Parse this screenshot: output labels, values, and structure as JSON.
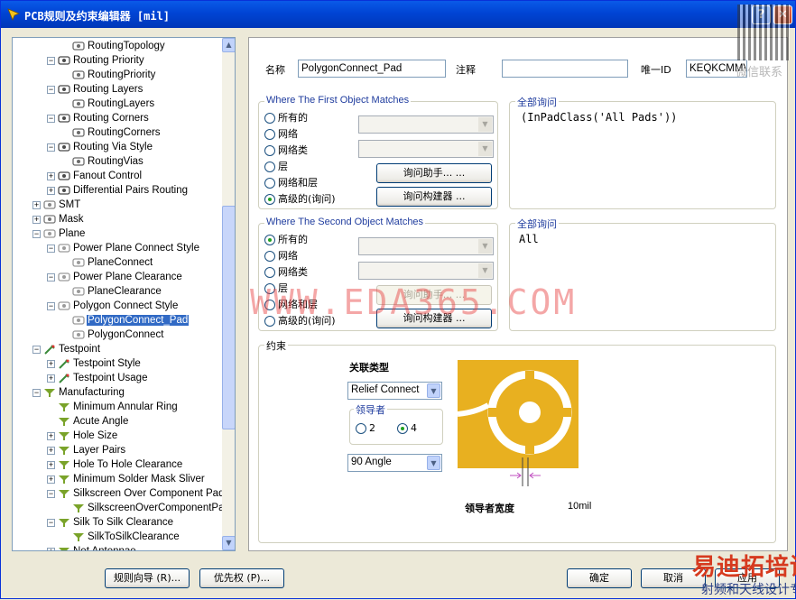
{
  "window": {
    "title": "PCB规则及约束编辑器 [mil]",
    "help_button": "?",
    "close_button": "✕"
  },
  "tree": {
    "items": [
      {
        "label": "RoutingTopology",
        "level": 3,
        "expander": "",
        "icon": "rule-icon",
        "selected": false
      },
      {
        "label": "Routing Priority",
        "level": 2,
        "expander": "−",
        "icon": "routing-icon",
        "selected": false
      },
      {
        "label": "RoutingPriority",
        "level": 3,
        "expander": "",
        "icon": "rule-icon",
        "selected": false
      },
      {
        "label": "Routing Layers",
        "level": 2,
        "expander": "−",
        "icon": "routing-icon",
        "selected": false
      },
      {
        "label": "RoutingLayers",
        "level": 3,
        "expander": "",
        "icon": "rule-icon",
        "selected": false
      },
      {
        "label": "Routing Corners",
        "level": 2,
        "expander": "−",
        "icon": "routing-icon",
        "selected": false
      },
      {
        "label": "RoutingCorners",
        "level": 3,
        "expander": "",
        "icon": "rule-icon",
        "selected": false
      },
      {
        "label": "Routing Via Style",
        "level": 2,
        "expander": "−",
        "icon": "routing-icon",
        "selected": false
      },
      {
        "label": "RoutingVias",
        "level": 3,
        "expander": "",
        "icon": "rule-icon",
        "selected": false
      },
      {
        "label": "Fanout Control",
        "level": 2,
        "expander": "+",
        "icon": "routing-icon",
        "selected": false
      },
      {
        "label": "Differential Pairs Routing",
        "level": 2,
        "expander": "+",
        "icon": "routing-icon",
        "selected": false
      },
      {
        "label": "SMT",
        "level": 1,
        "expander": "+",
        "icon": "smt-icon",
        "selected": false
      },
      {
        "label": "Mask",
        "level": 1,
        "expander": "+",
        "icon": "mask-icon",
        "selected": false
      },
      {
        "label": "Plane",
        "level": 1,
        "expander": "−",
        "icon": "plane-icon",
        "selected": false
      },
      {
        "label": "Power Plane Connect Style",
        "level": 2,
        "expander": "−",
        "icon": "plane-icon",
        "selected": false
      },
      {
        "label": "PlaneConnect",
        "level": 3,
        "expander": "",
        "icon": "plane-icon",
        "selected": false
      },
      {
        "label": "Power Plane Clearance",
        "level": 2,
        "expander": "−",
        "icon": "plane-icon",
        "selected": false
      },
      {
        "label": "PlaneClearance",
        "level": 3,
        "expander": "",
        "icon": "plane-icon",
        "selected": false
      },
      {
        "label": "Polygon Connect Style",
        "level": 2,
        "expander": "−",
        "icon": "plane-icon",
        "selected": false
      },
      {
        "label": "PolygonConnect_Pad",
        "level": 3,
        "expander": "",
        "icon": "plane-icon",
        "selected": true
      },
      {
        "label": "PolygonConnect",
        "level": 3,
        "expander": "",
        "icon": "plane-icon",
        "selected": false
      },
      {
        "label": "Testpoint",
        "level": 1,
        "expander": "−",
        "icon": "testpoint-icon",
        "selected": false
      },
      {
        "label": "Testpoint Style",
        "level": 2,
        "expander": "+",
        "icon": "testpoint-icon",
        "selected": false
      },
      {
        "label": "Testpoint Usage",
        "level": 2,
        "expander": "+",
        "icon": "testpoint-icon",
        "selected": false
      },
      {
        "label": "Manufacturing",
        "level": 1,
        "expander": "−",
        "icon": "manufacturing-icon",
        "selected": false
      },
      {
        "label": "Minimum Annular Ring",
        "level": 2,
        "expander": "",
        "icon": "manufacturing-icon",
        "selected": false
      },
      {
        "label": "Acute Angle",
        "level": 2,
        "expander": "",
        "icon": "manufacturing-icon",
        "selected": false
      },
      {
        "label": "Hole Size",
        "level": 2,
        "expander": "+",
        "icon": "manufacturing-icon",
        "selected": false
      },
      {
        "label": "Layer Pairs",
        "level": 2,
        "expander": "+",
        "icon": "manufacturing-icon",
        "selected": false
      },
      {
        "label": "Hole To Hole Clearance",
        "level": 2,
        "expander": "+",
        "icon": "manufacturing-icon",
        "selected": false
      },
      {
        "label": "Minimum Solder Mask Sliver",
        "level": 2,
        "expander": "+",
        "icon": "manufacturing-icon",
        "selected": false
      },
      {
        "label": "Silkscreen Over Component Pads",
        "level": 2,
        "expander": "−",
        "icon": "manufacturing-icon",
        "selected": false
      },
      {
        "label": "SilkscreenOverComponentPad",
        "level": 3,
        "expander": "",
        "icon": "manufacturing-icon",
        "selected": false
      },
      {
        "label": "Silk To Silk Clearance",
        "level": 2,
        "expander": "−",
        "icon": "manufacturing-icon",
        "selected": false
      },
      {
        "label": "SilkToSilkClearance",
        "level": 3,
        "expander": "",
        "icon": "manufacturing-icon",
        "selected": false
      },
      {
        "label": "Net Antennae",
        "level": 2,
        "expander": "+",
        "icon": "manufacturing-icon",
        "selected": false
      }
    ]
  },
  "header": {
    "name_label": "名称",
    "name_value": "PolygonConnect_Pad",
    "comment_label": "注释",
    "comment_value": "",
    "uid_label": "唯一ID",
    "uid_value": "KEQKCMMV"
  },
  "first": {
    "title": "Where The First Object Matches",
    "options": [
      "所有的",
      "网络",
      "网络类",
      "层",
      "网络和层",
      "高级的(询问)"
    ],
    "selected_index": 5,
    "helper_button": "询问助手... ...",
    "builder_button": "询问构建器 ...",
    "query_title": "全部询问",
    "query_text": "(InPadClass('All Pads'))"
  },
  "second": {
    "title": "Where The Second Object Matches",
    "options": [
      "所有的",
      "网络",
      "网络类",
      "层",
      "网络和层",
      "高级的(询问)"
    ],
    "selected_index": 0,
    "helper_button": "询问助手... ...",
    "builder_button": "询问构建器 ...",
    "query_title": "全部询问",
    "query_text": "All"
  },
  "constraints": {
    "title": "约束",
    "connect_type_label": "关联类型",
    "connect_type_value": "Relief Connect",
    "conductors_label": "领导者",
    "conductor_options": [
      "2",
      "4"
    ],
    "conductor_selected": "4",
    "angle_value": "90 Angle",
    "width_label": "领导者宽度",
    "width_value": "10mil",
    "pad_color": "#e8b020"
  },
  "footer": {
    "wizard_button": "规则向导 (R)...",
    "priority_button": "优先权 (P)...",
    "ok_button": "确定",
    "cancel_button": "取消",
    "apply_button": "应用"
  },
  "overlays": {
    "watermark": "WWW.EDA365.COM",
    "brand_main": "易迪拓培训",
    "brand_sub": "射频和天线设计专家",
    "qr_caption": "微信联系"
  }
}
